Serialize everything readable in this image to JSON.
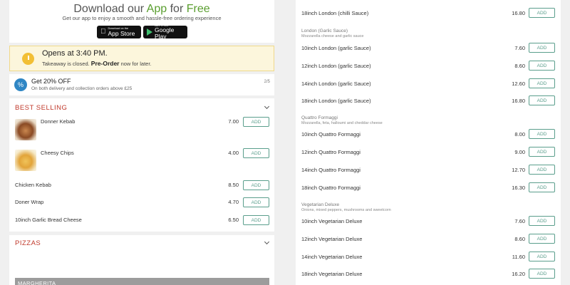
{
  "download": {
    "title_pre": "Download our",
    "title_app": "App",
    "title_mid": "for",
    "title_free": "Free",
    "subtitle": "Get our app to enjoy a smooth and hassle-free ordering experience",
    "app_store_small": "Download on the",
    "app_store_big": "App Store",
    "google_play_small": "GET IT ON",
    "google_play_big": "Google Play"
  },
  "status": {
    "title": "Opens at 3:40 PM.",
    "sub_pre": "Takeaway is closed.",
    "sub_bold": "Pre-Order",
    "sub_post": "now for later."
  },
  "offer": {
    "icon": "%",
    "title": "Get 20% OFF",
    "subtitle": "On both delivery and collection orders above £25",
    "counter": "2/5"
  },
  "add_label": "ADD",
  "best_selling": {
    "title": "BEST SELLING",
    "items": [
      {
        "name": "Donner Kebab",
        "price": "7.00",
        "image": "kebab"
      },
      {
        "name": "Cheesy Chips",
        "price": "4.00",
        "image": "chips"
      },
      {
        "name": "Chicken Kebab",
        "price": "8.50"
      },
      {
        "name": "Doner Wrap",
        "price": "4.70"
      },
      {
        "name": "10inch Garlic Bread Cheese",
        "price": "6.50"
      }
    ]
  },
  "pizzas": {
    "title": "PIZZAS",
    "first_item": "MARGHERITA"
  },
  "menu": {
    "top_item": {
      "name": "18inch London (chilli Sauce)",
      "price": "16.80"
    },
    "groups": [
      {
        "name": "London (Garlic Sauce)",
        "desc": "Mozzarella cheese and garlic sauce",
        "items": [
          {
            "name": "10inch London (garlic Sauce)",
            "price": "7.60"
          },
          {
            "name": "12inch London (garlic Sauce)",
            "price": "8.60"
          },
          {
            "name": "14inch London (garlic Sauce)",
            "price": "12.60"
          },
          {
            "name": "18inch London (garlic Sauce)",
            "price": "16.80"
          }
        ]
      },
      {
        "name": "Quattro Formaggi",
        "desc": "Mozzarella, feta, halloumi and cheddar cheese",
        "items": [
          {
            "name": "10inch Quattro Formaggi",
            "price": "8.00"
          },
          {
            "name": "12inch Quattro Formaggi",
            "price": "9.00"
          },
          {
            "name": "14inch Quattro Formaggi",
            "price": "12.70"
          },
          {
            "name": "18inch Quattro Formaggi",
            "price": "16.30"
          }
        ]
      },
      {
        "name": "Vegetarian Deluxe",
        "desc": "Onions, mixed peppers, mushrooms and sweetcorn",
        "items": [
          {
            "name": "10inch Vegetarian Deluxe",
            "price": "7.60"
          },
          {
            "name": "12inch Vegetarian Deluxe",
            "price": "8.60"
          },
          {
            "name": "14inch Vegetarian Deluxe",
            "price": "11.60"
          },
          {
            "name": "18inch Vegetarian Deluxe",
            "price": "16.20"
          }
        ]
      }
    ]
  }
}
